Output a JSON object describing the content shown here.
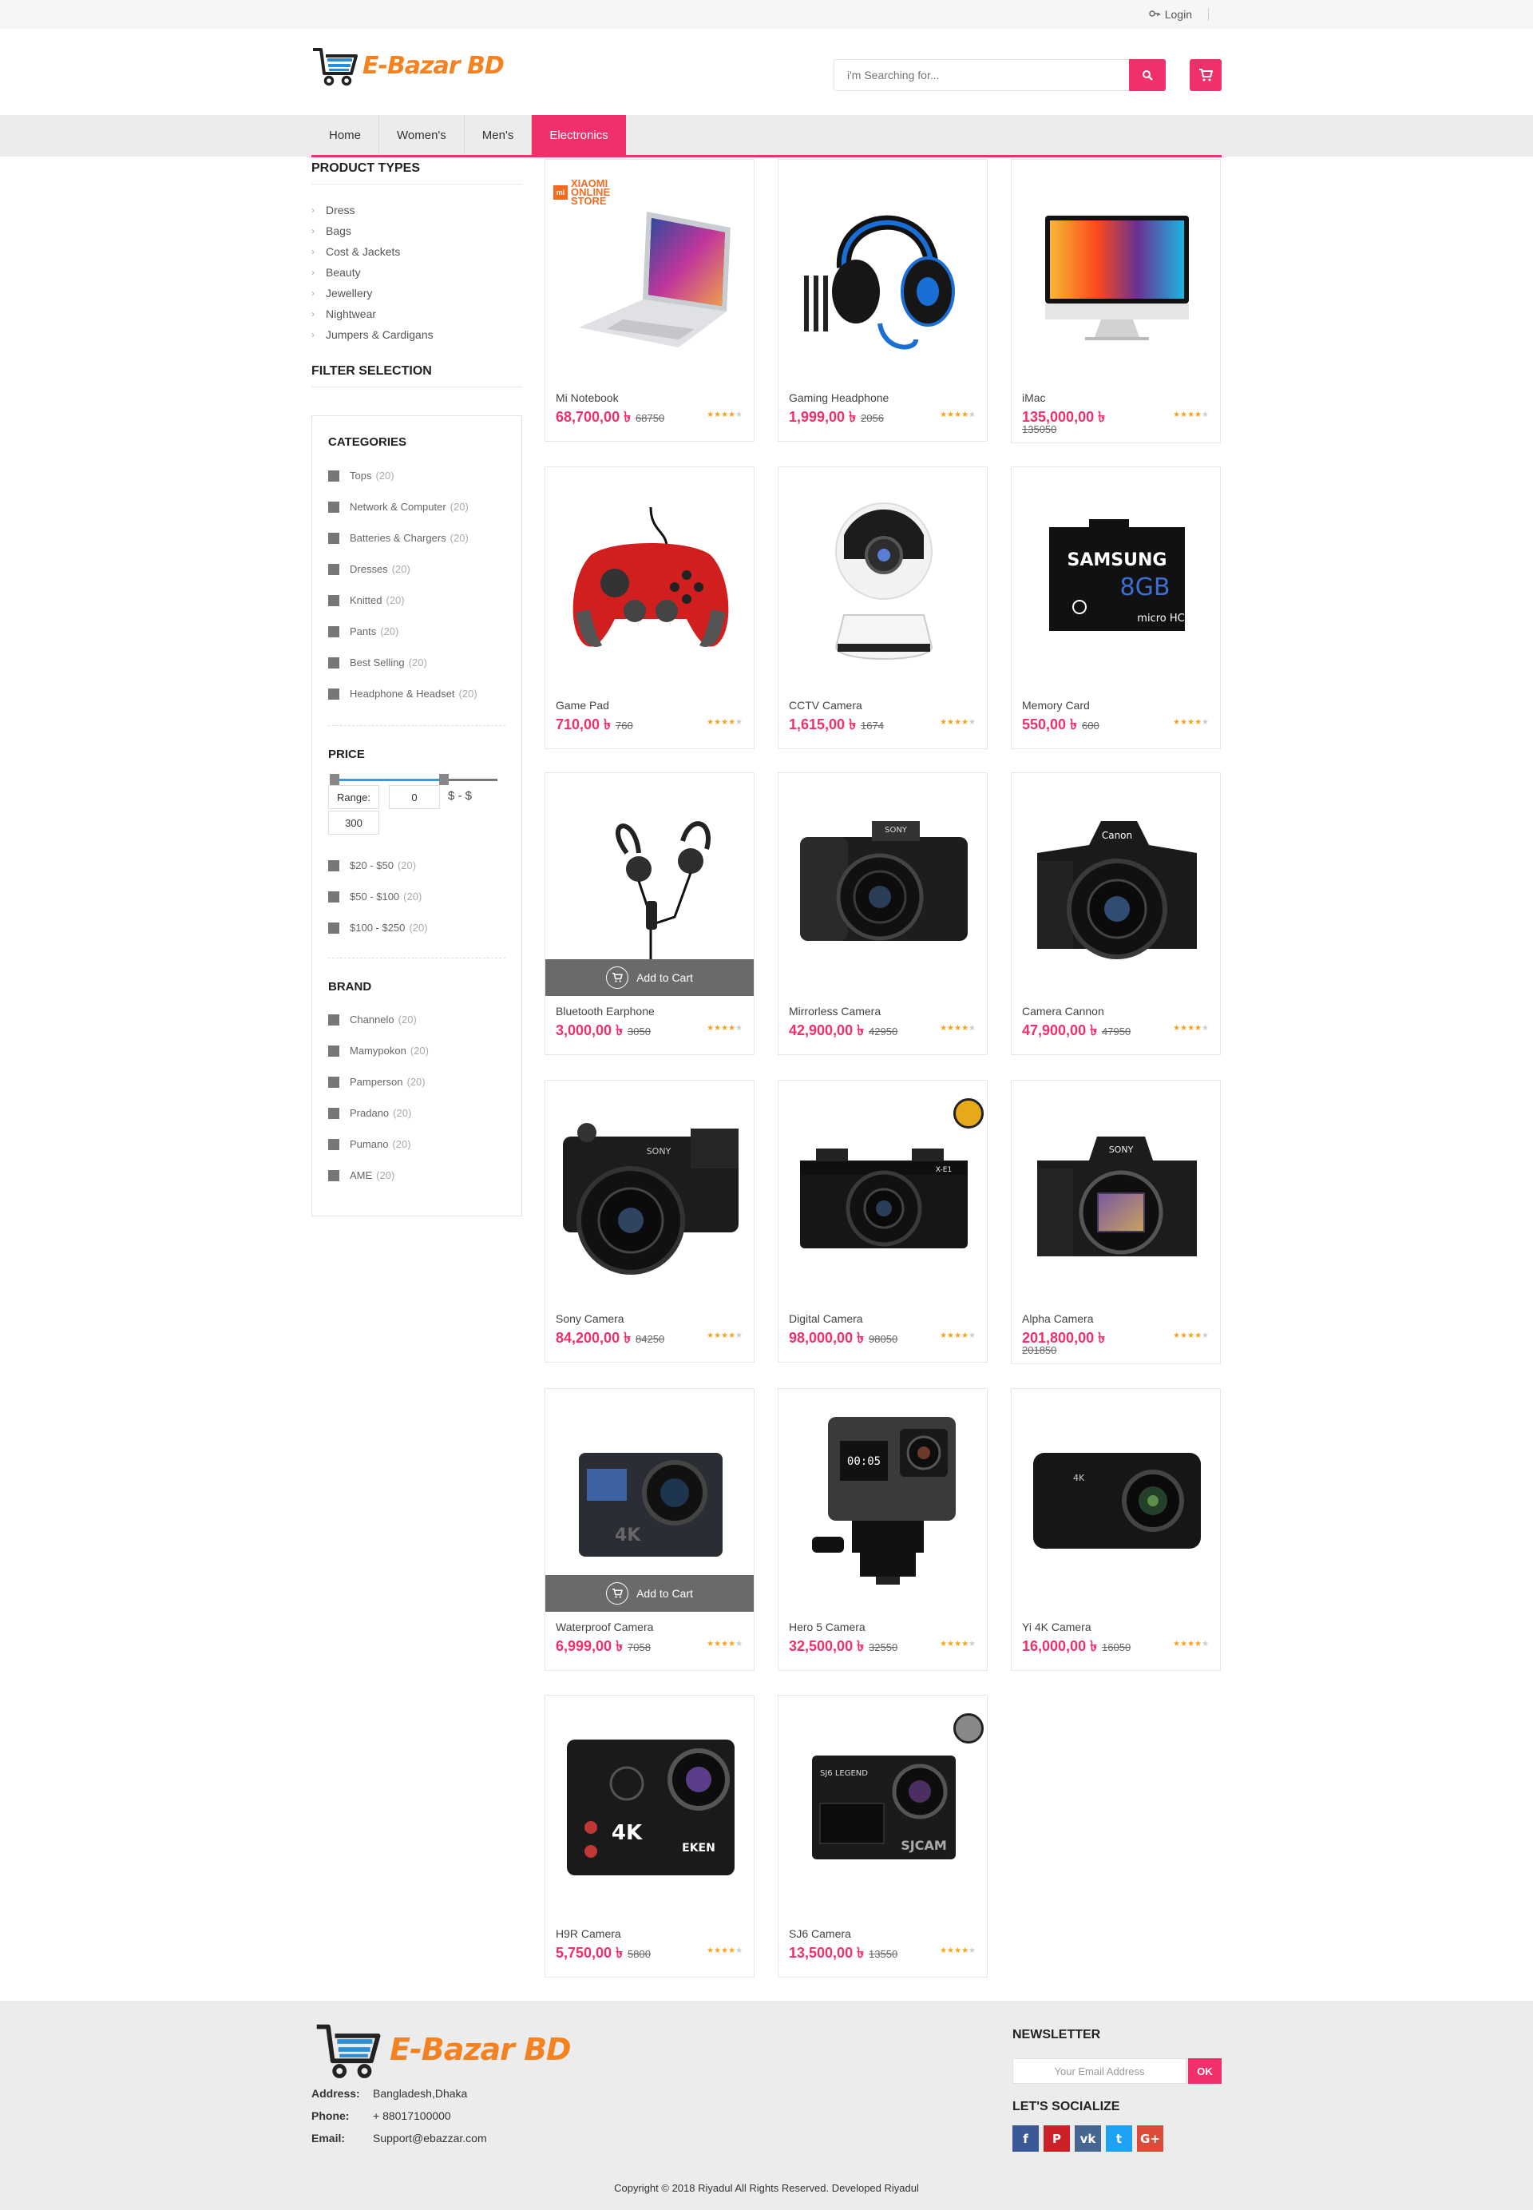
{
  "topbar": {
    "login_label": "Login"
  },
  "header": {
    "logo_text": "E-Bazar BD",
    "search_placeholder": "i'm Searching for..."
  },
  "nav": {
    "items": [
      "Home",
      "Women's",
      "Men's",
      "Electronics"
    ],
    "active": "Electronics"
  },
  "sidebar": {
    "product_types_title": "PRODUCT TYPES",
    "product_types": [
      "Dress",
      "Bags",
      "Cost & Jackets",
      "Beauty",
      "Jewellery",
      "Nightwear",
      "Jumpers & Cardigans"
    ],
    "filter_title": "FILTER SELECTION",
    "categories_title": "CATEGORIES",
    "categories": [
      {
        "label": "Tops",
        "count": "(20)"
      },
      {
        "label": "Network & Computer",
        "count": "(20)"
      },
      {
        "label": "Batteries & Chargers",
        "count": "(20)"
      },
      {
        "label": "Dresses",
        "count": "(20)"
      },
      {
        "label": "Knitted",
        "count": "(20)"
      },
      {
        "label": "Pants",
        "count": "(20)"
      },
      {
        "label": "Best Selling",
        "count": "(20)"
      },
      {
        "label": "Headphone & Headset",
        "count": "(20)"
      }
    ],
    "price_title": "PRICE",
    "range_label": "Range:",
    "range_min": "0",
    "range_sep": "$ - $",
    "range_max": "300",
    "slider_fraction": 0.67,
    "price_ranges": [
      {
        "label": "$20 - $50",
        "count": "(20)"
      },
      {
        "label": "$50 - $100",
        "count": "(20)"
      },
      {
        "label": "$100 - $250",
        "count": "(20)"
      }
    ],
    "brand_title": "BRAND",
    "brands": [
      {
        "label": "Channelo",
        "count": "(20)"
      },
      {
        "label": "Mamypokon",
        "count": "(20)"
      },
      {
        "label": "Pamperson",
        "count": "(20)"
      },
      {
        "label": "Pradano",
        "count": "(20)"
      },
      {
        "label": "Pumano",
        "count": "(20)"
      },
      {
        "label": "AME",
        "count": "(20)"
      }
    ]
  },
  "products": [
    {
      "name": "Mi Notebook",
      "price": "68,700,00 ৳",
      "old": "68750",
      "rating": 4,
      "icon": "laptop",
      "badge": "XIAOMI ONLINE STORE"
    },
    {
      "name": "Gaming Headphone",
      "price": "1,999,00 ৳",
      "old": "2056",
      "rating": 4,
      "icon": "headphone"
    },
    {
      "name": "iMac",
      "price": "135,000,00 ৳",
      "old": "135050",
      "rating": 4,
      "icon": "imac",
      "wrap": true
    },
    {
      "name": "Game Pad",
      "price": "710,00 ৳",
      "old": "760",
      "rating": 4,
      "icon": "gamepad"
    },
    {
      "name": "CCTV Camera",
      "price": "1,615,00 ৳",
      "old": "1674",
      "rating": 4,
      "icon": "cctv"
    },
    {
      "name": "Memory Card",
      "price": "550,00 ৳",
      "old": "600",
      "rating": 4,
      "icon": "sdcard",
      "card_brand": "SAMSUNG",
      "card_size": "8GB"
    },
    {
      "name": "Bluetooth Earphone",
      "price": "3,000,00 ৳",
      "old": "3050",
      "rating": 4,
      "icon": "earphone",
      "add_to_cart": true
    },
    {
      "name": "Mirrorless Camera",
      "price": "42,900,00 ৳",
      "old": "42950",
      "rating": 4,
      "icon": "camera-sony"
    },
    {
      "name": "Camera Cannon",
      "price": "47,900,00 ৳",
      "old": "47950",
      "rating": 4,
      "icon": "camera-canon"
    },
    {
      "name": "Sony Camera",
      "price": "84,200,00 ৳",
      "old": "84250",
      "rating": 4,
      "icon": "camera-sony2"
    },
    {
      "name": "Digital Camera",
      "price": "98,000,00 ৳",
      "old": "98050",
      "rating": 4,
      "icon": "camera-fuji"
    },
    {
      "name": "Alpha Camera",
      "price": "201,800,00 ৳",
      "old": "201850",
      "rating": 4,
      "icon": "camera-alpha",
      "wrap": true
    },
    {
      "name": "Waterproof Camera",
      "price": "6,999,00 ৳",
      "old": "7058",
      "rating": 4,
      "icon": "action",
      "add_to_cart": true
    },
    {
      "name": "Hero 5 Camera",
      "price": "32,500,00 ৳",
      "old": "32550",
      "rating": 4,
      "icon": "gopro"
    },
    {
      "name": "Yi 4K Camera",
      "price": "16,000,00 ৳",
      "old": "16050",
      "rating": 4,
      "icon": "yi"
    },
    {
      "name": "H9R Camera",
      "price": "5,750,00 ৳",
      "old": "5800",
      "rating": 4,
      "icon": "eken"
    },
    {
      "name": "SJ6 Camera",
      "price": "13,500,00 ৳",
      "old": "13550",
      "rating": 4,
      "icon": "sjcam"
    }
  ],
  "add_to_cart_label": "Add to Cart",
  "footer": {
    "logo_text": "E-Bazar BD",
    "address_label": "Address:",
    "address": "Bangladesh,Dhaka",
    "phone_label": "Phone:",
    "phone": "+ 88017100000",
    "email_label": "Email:",
    "email": "Support@ebazzar.com",
    "newsletter_title": "NEWSLETTER",
    "newsletter_placeholder": "Your Email Address",
    "newsletter_button": "OK",
    "social_title": "LET'S SOCIALIZE",
    "socials": [
      {
        "name": "facebook",
        "glyph": "f",
        "color": "#3b5998"
      },
      {
        "name": "pinterest",
        "glyph": "P",
        "color": "#cb2027"
      },
      {
        "name": "vk",
        "glyph": "vk",
        "color": "#45668e"
      },
      {
        "name": "twitter",
        "glyph": "t",
        "color": "#1da1f2"
      },
      {
        "name": "google-plus",
        "glyph": "G+",
        "color": "#dd4b39"
      }
    ],
    "copyright": "Copyright © 2018 Riyadul All Rights Reserved. Developed Riyadul"
  },
  "colors": {
    "accent": "#f0306a",
    "logo": "#f58220",
    "star": "#f7a21b"
  }
}
